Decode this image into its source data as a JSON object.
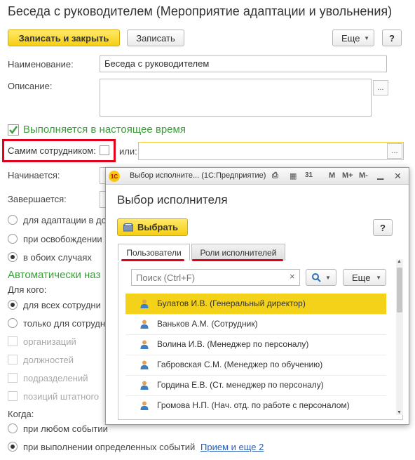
{
  "window": {
    "title": "Беседа с руководителем (Мероприятие адаптации и увольнения)"
  },
  "toolbar": {
    "save_close": "Записать и закрыть",
    "save": "Записать",
    "more": "Еще",
    "help": "?"
  },
  "form": {
    "name_label": "Наименование:",
    "name_value": "Беседа с руководителем",
    "description_label": "Описание:",
    "description_value": "",
    "dots": "...",
    "performed_now": "Выполняется в настоящее время",
    "by_employee_label": "Самим сотрудником:",
    "or_label": "или:",
    "starts_label": "Начинается:",
    "ends_label": "Завершается:",
    "options": [
      {
        "label": "для адаптации в до",
        "selected": false
      },
      {
        "label": "при освобождении",
        "selected": false
      },
      {
        "label": "в обоих случаях",
        "selected": true
      }
    ],
    "auto_title": "Автоматически наз",
    "for_whom_label": "Для кого:",
    "whom_options": [
      {
        "label": "для всех сотрудни",
        "selected": true
      },
      {
        "label": "только для сотрудн",
        "selected": false
      }
    ],
    "filters": [
      "организаций",
      "должностей",
      "подразделений",
      "позиций штатного"
    ],
    "when_label": "Когда:",
    "when_options": [
      {
        "label": "при любом событии",
        "selected": false
      },
      {
        "label": "при выполнении определенных событий",
        "selected": true
      }
    ],
    "events_link": "Прием и еще 2"
  },
  "dialog": {
    "window_title": "Выбор исполните... (1С:Предприятие)",
    "logo": "1С",
    "toolbar_icons": [
      "M",
      "M+",
      "M-"
    ],
    "heading": "Выбор исполнителя",
    "choose_button": "Выбрать",
    "help": "?",
    "tabs": [
      "Пользователи",
      "Роли исполнителей"
    ],
    "search_placeholder": "Поиск (Ctrl+F)",
    "search_clear": "×",
    "more": "Еще",
    "users": [
      "Булатов И.В. (Генеральный директор)",
      "Ваньков А.М. (Сотрудник)",
      "Волина И.В. (Менеджер по персоналу)",
      "Габровская С.М. (Менеджер по обучению)",
      "Гордина Е.В. (Ст. менеджер по персоналу)",
      "Громова Н.П. (Нач. отд. по работе с персоналом)"
    ],
    "selected_index": 0
  },
  "colors": {
    "accent_yellow": "#f5cf12",
    "highlight_red": "#e3001b",
    "green_title": "#3b9d3b",
    "link_blue": "#2a5db0"
  }
}
